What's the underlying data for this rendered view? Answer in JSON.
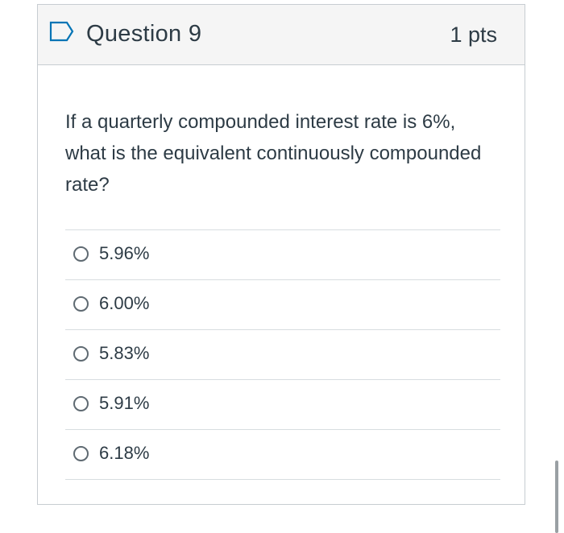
{
  "question": {
    "title": "Question 9",
    "points": "1 pts",
    "flag_icon": "flag-outline-icon",
    "text": "If a quarterly compounded interest rate is 6%, what is the equivalent continuously compounded rate?",
    "answers": [
      {
        "label": "5.96%"
      },
      {
        "label": "6.00%"
      },
      {
        "label": "5.83%"
      },
      {
        "label": "5.91%"
      },
      {
        "label": "6.18%"
      }
    ]
  },
  "colors": {
    "accent": "#0374b5",
    "text": "#2d3b45",
    "header_bg": "#f5f5f5",
    "border": "#c7cdd1"
  }
}
